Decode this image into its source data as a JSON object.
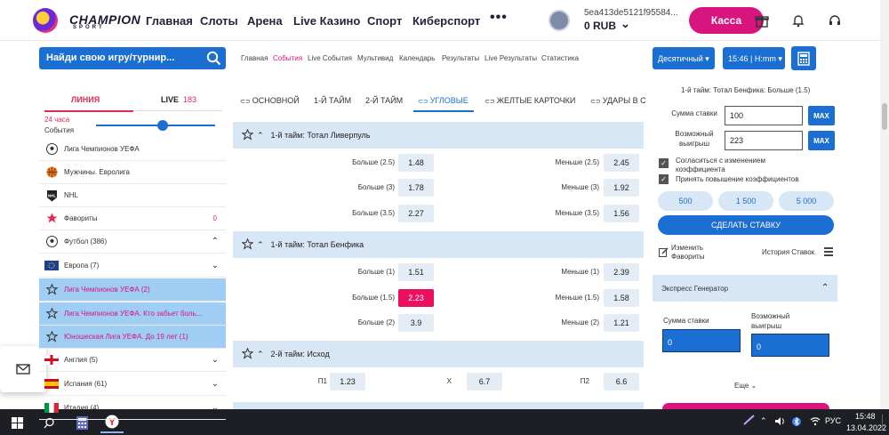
{
  "header": {
    "logo": "CHAMPION",
    "logo_sub": "SPORT",
    "nav": [
      "Главная",
      "Слоты",
      "Арена",
      "Live Казино",
      "Спорт",
      "Киберспорт"
    ],
    "more": "•••",
    "user_id": "5ea413de5121f95584...",
    "balance": "0 RUB",
    "kassa": "Касса",
    "icons": [
      "gift-icon",
      "bell-icon",
      "headset-icon"
    ]
  },
  "search": {
    "placeholder": "Найди свою игру/турнир..."
  },
  "breadcrumbs": [
    "Главная",
    "События",
    "Live События",
    "Мультивид",
    "Календарь",
    "Результаты",
    "Live Результаты",
    "Статистика"
  ],
  "odds_format": "Десятичный",
  "time_format": "15:46 | H:mm",
  "sidebar": {
    "tab_line": "ЛИНИЯ",
    "tab_live": "LIVE",
    "live_count": "183",
    "slider_label": "24 часа",
    "slider_sub": "События",
    "items": [
      {
        "label": "Лига Чемпионов УЕФА",
        "icon": "football-icon",
        "count": "",
        "chev": false,
        "hl": false
      },
      {
        "label": "Мужчины. Евролига",
        "icon": "basketball-icon",
        "count": "",
        "chev": false,
        "hl": false
      },
      {
        "label": "NHL",
        "icon": "nhl-icon",
        "count": "",
        "chev": false,
        "hl": false
      },
      {
        "label": "Фавориты",
        "icon": "star-icon",
        "count": "0",
        "chev": false,
        "hl": false
      },
      {
        "label": "Футбол (386)",
        "icon": "football-icon",
        "count": "",
        "chev": true,
        "up": true,
        "hl": false
      },
      {
        "label": "Европа (7)",
        "icon": "eu-flag-icon",
        "count": "",
        "chev": true,
        "hl": false
      },
      {
        "label": "Лига Чемпионов УЕФА (2)",
        "icon": "star-outline-icon",
        "count": "",
        "chev": false,
        "hl": true
      },
      {
        "label": "Лига Чемпионов УЕФА. Кто забьет боль...",
        "icon": "star-outline-icon",
        "count": "",
        "chev": false,
        "hl": true
      },
      {
        "label": "Юношеская Лига УЕФА. До 19 лет (1)",
        "icon": "star-outline-icon",
        "count": "",
        "chev": false,
        "hl": true
      },
      {
        "label": "Англия (5)",
        "icon": "england-flag-icon",
        "count": "",
        "chev": true,
        "hl": false
      },
      {
        "label": "Испания (61)",
        "icon": "spain-flag-icon",
        "count": "",
        "chev": true,
        "hl": false
      },
      {
        "label": "Италия (4)",
        "icon": "italy-flag-icon",
        "count": "",
        "chev": true,
        "hl": false
      }
    ]
  },
  "main": {
    "tabs": [
      "ОСНОВНОЙ",
      "1-Й ТАЙМ",
      "2-Й ТАЙМ",
      "УГЛОВЫЕ",
      "ЖЕЛТЫЕ КАРТОЧКИ",
      "УДАРЫ В С"
    ],
    "active_tab": 3,
    "markets": [
      {
        "title": "1-й тайм: Тотал Ливерпуль",
        "rows": [
          {
            "l_label": "Больше (2.5)",
            "l_odd": "1.48",
            "r_label": "Меньше (2.5)",
            "r_odd": "2.45"
          },
          {
            "l_label": "Больше (3)",
            "l_odd": "1.78",
            "r_label": "Меньше (3)",
            "r_odd": "1.92"
          },
          {
            "l_label": "Больше (3.5)",
            "l_odd": "2.27",
            "r_label": "Меньше (3.5)",
            "r_odd": "1.56"
          }
        ]
      },
      {
        "title": "1-й тайм: Тотал Бенфика",
        "rows": [
          {
            "l_label": "Больше (1)",
            "l_odd": "1.51",
            "r_label": "Меньше (1)",
            "r_odd": "2.39"
          },
          {
            "l_label": "Больше (1.5)",
            "l_odd": "2.23",
            "r_label": "Меньше (1.5)",
            "r_odd": "1.58",
            "selected": true
          },
          {
            "l_label": "Больше (2)",
            "l_odd": "3.9",
            "r_label": "Меньше (2)",
            "r_odd": "1.21"
          }
        ]
      },
      {
        "title": "2-й тайм: Исход",
        "three": [
          {
            "label": "П1",
            "odd": "1.23"
          },
          {
            "label": "Х",
            "odd": "6.7"
          },
          {
            "label": "П2",
            "odd": "6.6"
          }
        ]
      }
    ]
  },
  "slip": {
    "selection": "1-й тайм: Тотал Бенфика: Больше (1.5)",
    "stake_label": "Сумма ставки",
    "stake": "100",
    "win_label": "Возможный выигрыш",
    "win": "223",
    "max": "MAX",
    "accept_change": "Согласиться с изменением коэффициента",
    "accept_raise": "Принять повышение коэффициентов",
    "quick": [
      "500",
      "1 500",
      "5 000"
    ],
    "place": "СДЕЛАТЬ СТАВКУ",
    "edit_fav": "Изменить Фавориты",
    "history": "История Ставок",
    "express_title": "Экспресс Генератор",
    "exp_stake_label": "Сумма ставки",
    "exp_win_label": "Возможный выигрыш",
    "exp_stake": "0",
    "exp_win": "0",
    "more": "Еще"
  },
  "taskbar": {
    "lang": "РУС",
    "time": "15:48",
    "date": "13.04.2022"
  },
  "colors": {
    "accent": "#1b6fd2",
    "brand": "#d8157e",
    "selected_odd": "#e8105f"
  }
}
